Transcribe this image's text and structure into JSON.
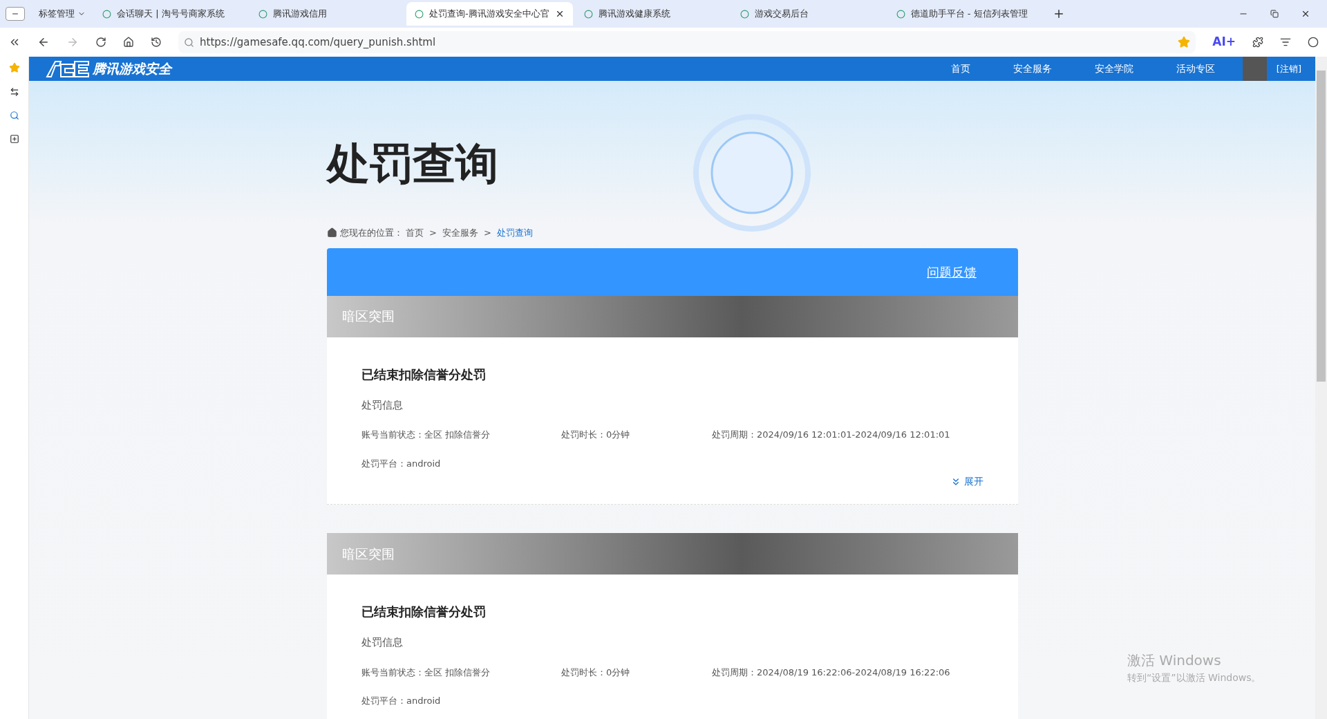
{
  "browser": {
    "tab_group": "标签管理",
    "tabs": [
      {
        "label": "会话聊天 | 淘号号商家系统",
        "selected": false
      },
      {
        "label": "腾讯游戏信用",
        "selected": false
      },
      {
        "label": "处罚查询-腾讯游戏安全中心官",
        "selected": true
      },
      {
        "label": "腾讯游戏健康系统",
        "selected": false
      },
      {
        "label": "游戏交易后台",
        "selected": false
      },
      {
        "label": "德道助手平台 - 短信列表管理",
        "selected": false
      }
    ],
    "address": "https://gamesafe.qq.com/query_punish.shtml",
    "ai_label": "AI+"
  },
  "site": {
    "logo_text": "腾讯游戏安全",
    "nav": [
      "首页",
      "安全服务",
      "安全学院",
      "活动专区"
    ],
    "logout": "[注销]"
  },
  "page": {
    "title": "处罚查询",
    "breadcrumb_prefix": "您现在的位置：",
    "breadcrumb": [
      {
        "label": "首页",
        "current": false
      },
      {
        "separator": ">",
        "label": "安全服务",
        "current": false
      },
      {
        "separator": ">",
        "label": "处罚查询",
        "current": true
      }
    ],
    "feedback": "问题反馈",
    "records": [
      {
        "game": "暗区突围",
        "title": "已结束扣除信誉分处罚",
        "section": "处罚信息",
        "status": "账号当前状态：全区 扣除信誉分",
        "duration": "处罚时长：0分钟",
        "period": "处罚周期：2024/09/16 12:01:01-2024/09/16 12:01:01",
        "platform": "处罚平台：android",
        "expand": "展开"
      },
      {
        "game": "暗区突围",
        "title": "已结束扣除信誉分处罚",
        "section": "处罚信息",
        "status": "账号当前状态：全区 扣除信誉分",
        "duration": "处罚时长：0分钟",
        "period": "处罚周期：2024/08/19 16:22:06-2024/08/19 16:22:06",
        "platform": "处罚平台：android"
      }
    ]
  },
  "os_notice": {
    "title": "激活 Windows",
    "subtitle": "转到“设置”以激活 Windows。"
  }
}
